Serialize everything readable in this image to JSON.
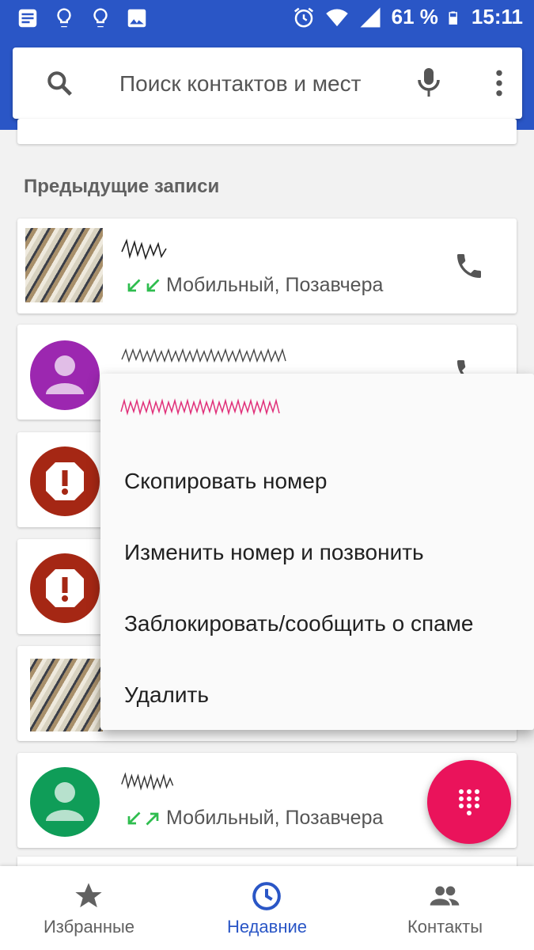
{
  "status_bar": {
    "battery_percent": "61 %",
    "time": "15:11",
    "icons": [
      "notification-icon",
      "lightbulb-icon",
      "lightbulb-icon",
      "image-icon",
      "alarm-icon",
      "wifi-icon",
      "signal-icon",
      "battery-icon"
    ]
  },
  "search": {
    "placeholder": "Поиск контактов и мест"
  },
  "section": {
    "header": "Предыдущие записи"
  },
  "calls": [
    {
      "meta": "Мобильный, Позавчера",
      "avatar": "photo",
      "direction": "incoming-incoming"
    },
    {
      "meta": "",
      "avatar": "person",
      "color": "#9c27b0"
    },
    {
      "meta": "",
      "avatar": "spam",
      "color": "#a52714"
    },
    {
      "meta": "",
      "avatar": "spam",
      "color": "#a52714"
    },
    {
      "meta": "",
      "avatar": "photo"
    },
    {
      "meta": "Мобильный, Позавчера",
      "avatar": "person",
      "color": "#0f9d58",
      "direction": "incoming-outgoing"
    }
  ],
  "menu": {
    "items": [
      "Скопировать номер",
      "Изменить номер и позвонить",
      "Заблокировать/сообщить о спаме",
      "Удалить"
    ]
  },
  "nav": {
    "tabs": [
      {
        "label": "Избранные",
        "icon": "star-icon",
        "active": false
      },
      {
        "label": "Недавние",
        "icon": "clock-icon",
        "active": true
      },
      {
        "label": "Контакты",
        "icon": "people-icon",
        "active": false
      }
    ]
  },
  "colors": {
    "primary": "#2a56c6",
    "fab": "#ea135b",
    "arrow_green": "#2fbd4f"
  }
}
